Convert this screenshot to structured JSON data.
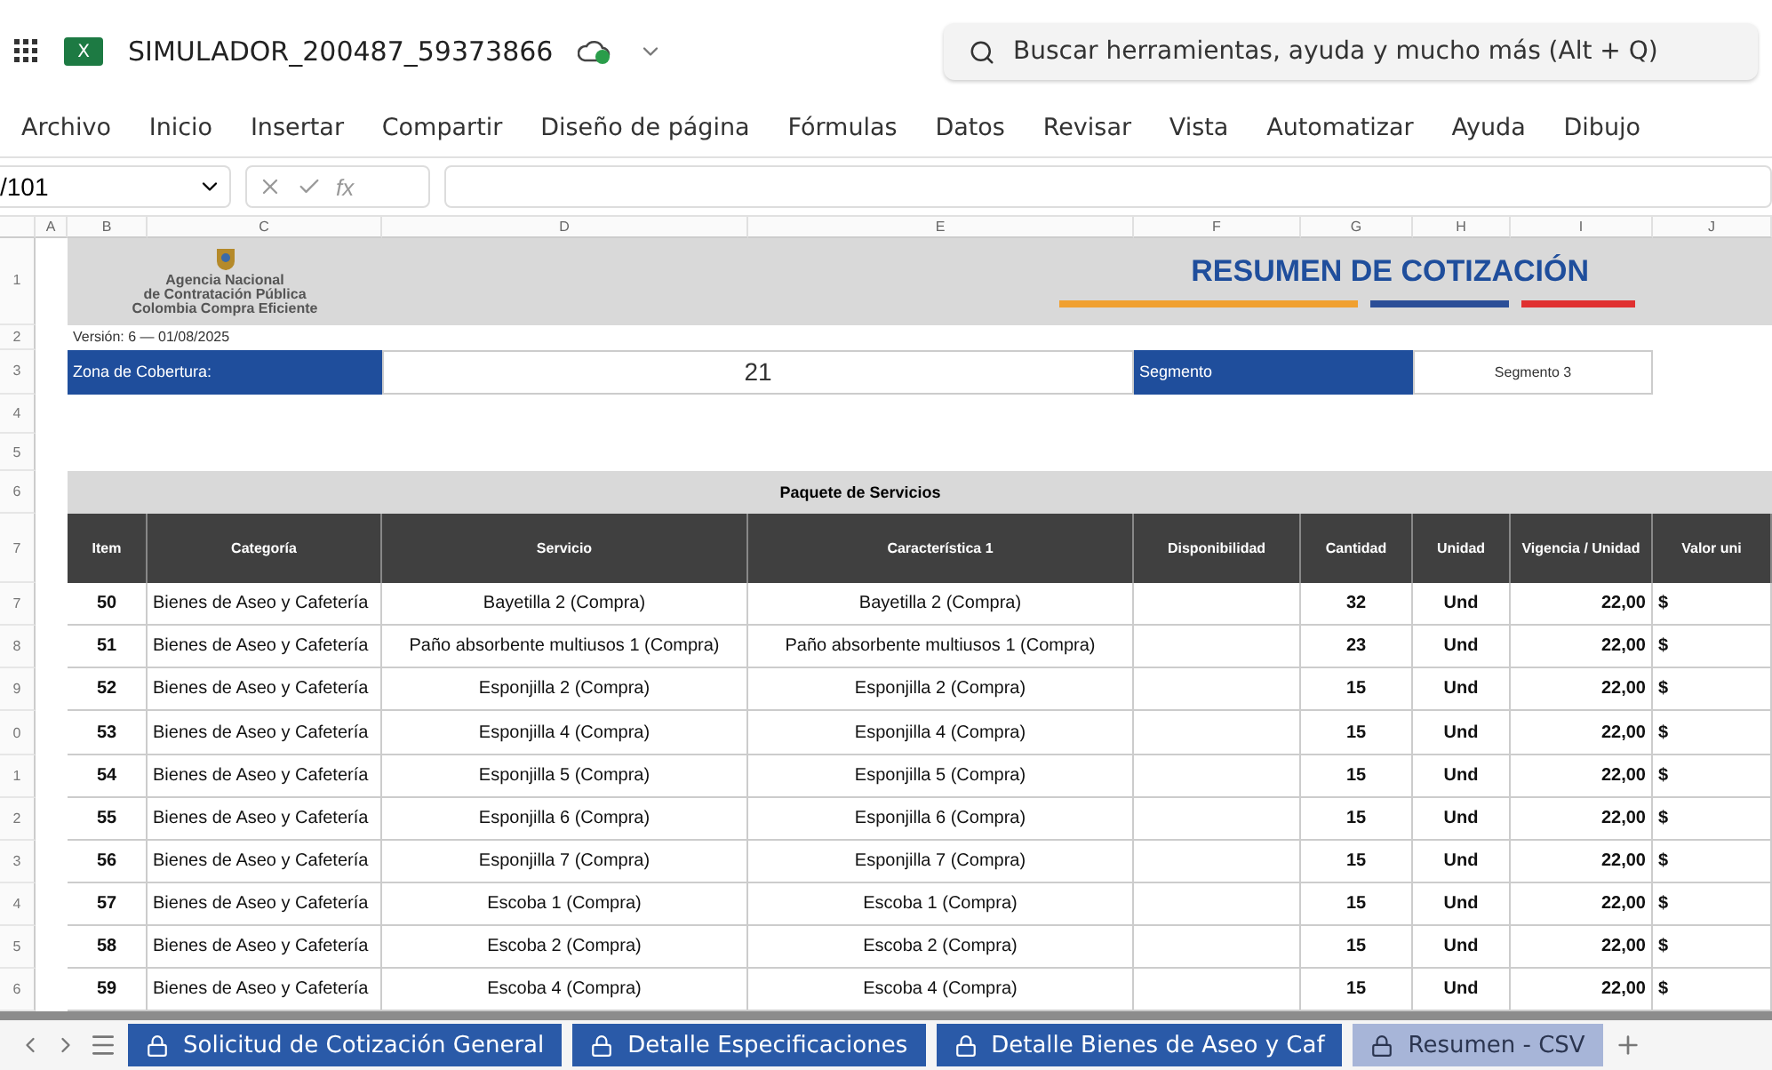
{
  "app": {
    "logo_letter": "X",
    "file_name": "SIMULADOR_200487_59373866",
    "search_placeholder": "Buscar herramientas, ayuda y mucho más (Alt + Q)"
  },
  "ribbon_tabs": [
    {
      "label": "Archivo",
      "selected": false
    },
    {
      "label": "Inicio",
      "selected": false
    },
    {
      "label": "Insertar",
      "selected": false
    },
    {
      "label": "Compartir",
      "selected": false
    },
    {
      "label": "Diseño de página",
      "selected": false
    },
    {
      "label": "Fórmulas",
      "selected": false
    },
    {
      "label": "Datos",
      "selected": false
    },
    {
      "label": "Revisar",
      "selected": false
    },
    {
      "label": "Vista",
      "selected": false
    },
    {
      "label": "Automatizar",
      "selected": false
    },
    {
      "label": "Ayuda",
      "selected": false
    },
    {
      "label": "Dibujo",
      "selected": false
    }
  ],
  "formula_bar": {
    "name_box": "/101",
    "fx": "fx"
  },
  "column_headers": [
    "A",
    "B",
    "C",
    "D",
    "E",
    "F",
    "G",
    "H",
    "I",
    "J"
  ],
  "sheet": {
    "logo_lines": [
      "Agencia Nacional",
      "de Contratación Pública",
      "Colombia Compra Eficiente"
    ],
    "title": "RESUMEN DE COTIZACIÓN",
    "version": "Versión: 6 — 01/08/2025",
    "zona_label": "Zona de Cobertura:",
    "zona_value": "21",
    "segmento_label": "Segmento",
    "segmento_value": "Segmento 3",
    "package_title": "Paquete de Servicios",
    "header_row_numbers": [
      "1",
      "2",
      "3",
      "4",
      "5",
      "6",
      "7"
    ],
    "columns": [
      "Item",
      "Categoría",
      "Servicio",
      "Característica 1",
      "Disponibilidad",
      "Cantidad",
      "Unidad",
      "Vigencia / Unidad",
      "Valor uni"
    ],
    "rows": [
      {
        "row_number": "7",
        "item": "50",
        "categoria": "Bienes de Aseo y Cafetería",
        "servicio": "Bayetilla 2 (Compra)",
        "caracteristica": "Bayetilla 2 (Compra)",
        "cantidad": "32",
        "unidad": "Und",
        "vigencia": "22,00",
        "valor": "$"
      },
      {
        "row_number": "8",
        "item": "51",
        "categoria": "Bienes de Aseo y Cafetería",
        "servicio": "Paño absorbente multiusos 1 (Compra)",
        "caracteristica": "Paño absorbente multiusos 1 (Compra)",
        "cantidad": "23",
        "unidad": "Und",
        "vigencia": "22,00",
        "valor": "$"
      },
      {
        "row_number": "9",
        "item": "52",
        "categoria": "Bienes de Aseo y Cafetería",
        "servicio": "Esponjilla 2 (Compra)",
        "caracteristica": "Esponjilla 2 (Compra)",
        "cantidad": "15",
        "unidad": "Und",
        "vigencia": "22,00",
        "valor": "$"
      },
      {
        "row_number": "0",
        "item": "53",
        "categoria": "Bienes de Aseo y Cafetería",
        "servicio": "Esponjilla 4 (Compra)",
        "caracteristica": "Esponjilla 4 (Compra)",
        "cantidad": "15",
        "unidad": "Und",
        "vigencia": "22,00",
        "valor": "$"
      },
      {
        "row_number": "1",
        "item": "54",
        "categoria": "Bienes de Aseo y Cafetería",
        "servicio": "Esponjilla 5 (Compra)",
        "caracteristica": "Esponjilla 5 (Compra)",
        "cantidad": "15",
        "unidad": "Und",
        "vigencia": "22,00",
        "valor": "$"
      },
      {
        "row_number": "2",
        "item": "55",
        "categoria": "Bienes de Aseo y Cafetería",
        "servicio": "Esponjilla 6 (Compra)",
        "caracteristica": "Esponjilla 6 (Compra)",
        "cantidad": "15",
        "unidad": "Und",
        "vigencia": "22,00",
        "valor": "$"
      },
      {
        "row_number": "3",
        "item": "56",
        "categoria": "Bienes de Aseo y Cafetería",
        "servicio": "Esponjilla 7 (Compra)",
        "caracteristica": "Esponjilla 7 (Compra)",
        "cantidad": "15",
        "unidad": "Und",
        "vigencia": "22,00",
        "valor": "$"
      },
      {
        "row_number": "4",
        "item": "57",
        "categoria": "Bienes de Aseo y Cafetería",
        "servicio": "Escoba 1 (Compra)",
        "caracteristica": "Escoba 1 (Compra)",
        "cantidad": "15",
        "unidad": "Und",
        "vigencia": "22,00",
        "valor": "$"
      },
      {
        "row_number": "5",
        "item": "58",
        "categoria": "Bienes de Aseo y Cafetería",
        "servicio": "Escoba 2 (Compra)",
        "caracteristica": "Escoba 2 (Compra)",
        "cantidad": "15",
        "unidad": "Und",
        "vigencia": "22,00",
        "valor": "$"
      },
      {
        "row_number": "6",
        "item": "59",
        "categoria": "Bienes de Aseo y Cafetería",
        "servicio": "Escoba 4 (Compra)",
        "caracteristica": "Escoba 4 (Compra)",
        "cantidad": "15",
        "unidad": "Und",
        "vigencia": "22,00",
        "valor": "$"
      }
    ]
  },
  "sheet_tabs": [
    {
      "label": "Solicitud de Cotización General",
      "selected": false
    },
    {
      "label": "Detalle Especificaciones",
      "selected": false
    },
    {
      "label": "Detalle Bienes de Aseo y Caf",
      "selected": false
    },
    {
      "label": "Resumen - CSV",
      "selected": true
    }
  ]
}
